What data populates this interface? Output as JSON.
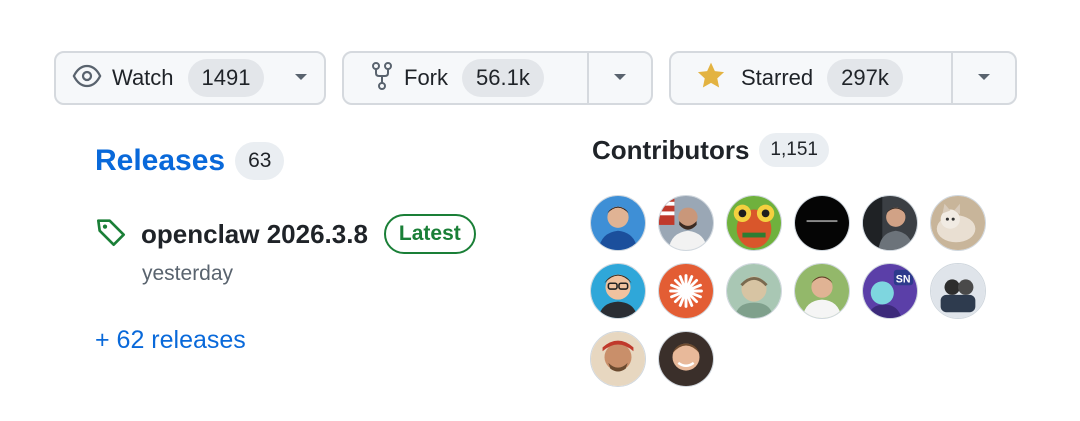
{
  "actions": {
    "watch": {
      "label": "Watch",
      "count": "1491",
      "icon": "eye-icon"
    },
    "fork": {
      "label": "Fork",
      "count": "56.1k",
      "icon": "fork-icon"
    },
    "star": {
      "label": "Starred",
      "count": "297k",
      "icon": "star-icon",
      "icon_color": "#e3b341"
    }
  },
  "releases": {
    "title": "Releases",
    "count": "63",
    "latest": {
      "name": "openclaw 2026.3.8",
      "badge": "Latest",
      "date": "yesterday",
      "icon": "tag-icon"
    },
    "more_link": "+ 62 releases"
  },
  "contributors": {
    "title": "Contributors",
    "count": "1,151",
    "avatars_count": 14
  },
  "colors": {
    "link": "#0969da",
    "latest_badge": "#1a7f37",
    "star": "#e3b341"
  }
}
